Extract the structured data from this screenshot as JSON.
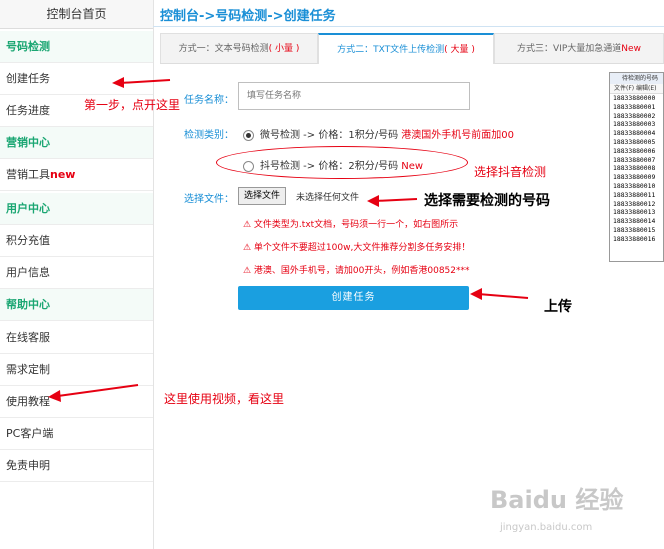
{
  "sidebar": {
    "title": "控制台首页",
    "items": [
      {
        "label": "号码检测",
        "type": "group"
      },
      {
        "label": "创建任务",
        "type": "link"
      },
      {
        "label": "任务进度",
        "type": "link"
      },
      {
        "label": "营销中心",
        "type": "group"
      },
      {
        "label": "营销工具",
        "badge": "new",
        "type": "link"
      },
      {
        "label": "用户中心",
        "type": "group"
      },
      {
        "label": "积分充值",
        "type": "link"
      },
      {
        "label": "用户信息",
        "type": "link"
      },
      {
        "label": "帮助中心",
        "type": "group"
      },
      {
        "label": "在线客服",
        "type": "link"
      },
      {
        "label": "需求定制",
        "type": "link"
      },
      {
        "label": "使用教程",
        "type": "link"
      },
      {
        "label": "PC客户端",
        "type": "link"
      },
      {
        "label": "免责申明",
        "type": "link"
      }
    ]
  },
  "breadcrumb": "控制台->号码检测->创建任务",
  "tabs": [
    {
      "label": "方式一：文本号码检测",
      "hint": "( 小量 )",
      "active": false
    },
    {
      "label": "方式二：TXT文件上传检测",
      "hint": "( 大量 )",
      "active": true
    },
    {
      "label": "方式三：VIP大量加急通道",
      "hint": "New",
      "active": false
    }
  ],
  "form": {
    "task_name_label": "任务名称：",
    "task_name_placeholder": "填写任务名称",
    "type_label": "检测类别：",
    "option1": "微号检测 -> 价格：1积分/号码",
    "option1_note": "港澳国外手机号前面加00",
    "option2": "抖号检测 -> 价格：2积分/号码",
    "option2_note": "New",
    "file_label": "选择文件：",
    "file_button": "选择文件",
    "file_status": "未选择任何文件",
    "warnings": [
      "⚠ 文件类型为.txt文档，号码须一行一个，如右图所示",
      "⚠ 单个文件不要超过100w,大文件推荐分割多任务安排！",
      "⚠ 港澳、国外手机号，请加00开头，例如香港00852***"
    ],
    "submit": "创建任务"
  },
  "annotations": {
    "step1": "第一步，点开这里",
    "choose_douyin": "选择抖音检测",
    "choose_numbers": "选择需要检测的号码",
    "upload": "上传",
    "tutorial": "这里使用视频，看这里"
  },
  "thumbnail": {
    "title": "待检测的号码",
    "menu": "文件(F)  编辑(E)",
    "lines": [
      "18833880000",
      "18833880001",
      "18833880002",
      "18833880003",
      "18833880004",
      "18833880005",
      "18833880006",
      "18833880007",
      "18833880008",
      "18833880009",
      "18833880010",
      "18833880011",
      "18833880012",
      "18833880013",
      "18833880014",
      "18833880015",
      "18833880016"
    ]
  },
  "watermark": {
    "main": "Baidu 经验",
    "sub": "jingyan.baidu.com"
  },
  "colors": {
    "accent": "#1a8fd6",
    "group": "#1aa672",
    "alert": "#e60012",
    "button": "#1a9fe0"
  }
}
